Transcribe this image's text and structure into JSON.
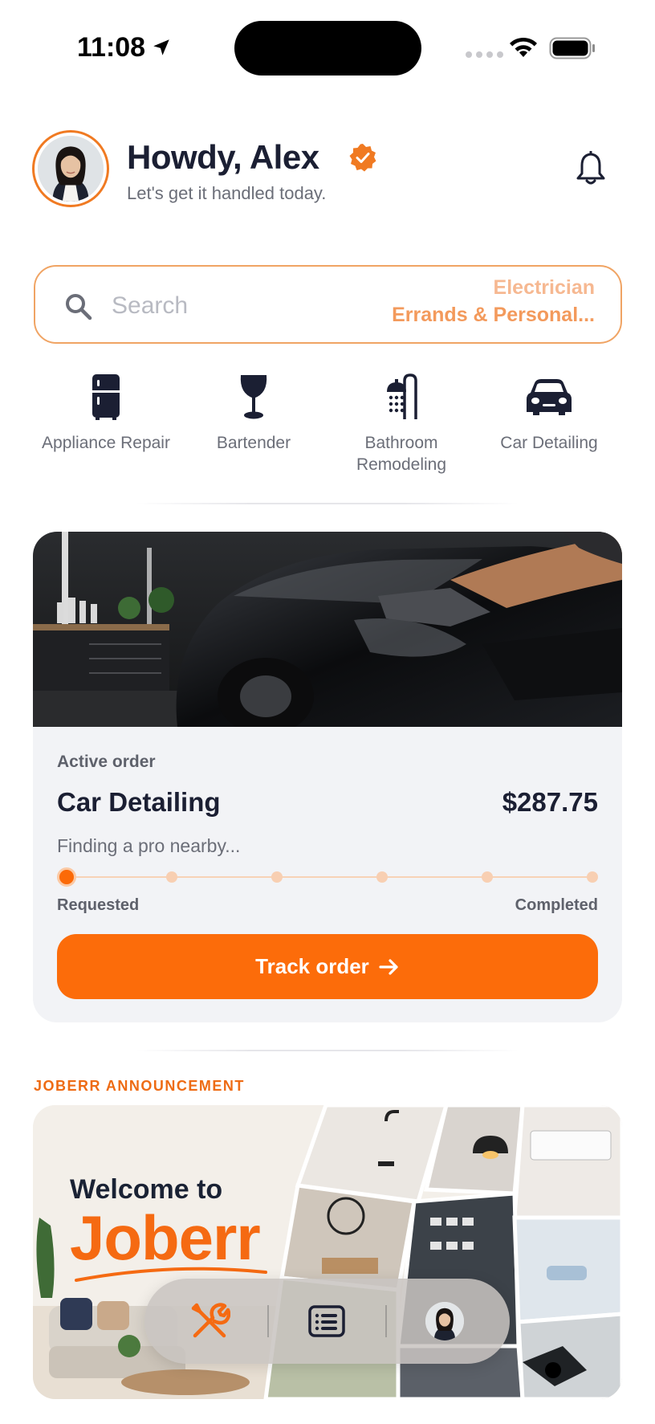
{
  "status_bar": {
    "time": "11:08",
    "icons": [
      "location-arrow-icon",
      "signal-dots-icon",
      "wifi-icon",
      "battery-icon"
    ]
  },
  "header": {
    "greeting": "Howdy, Alex",
    "subtitle": "Let's get it handled today.",
    "verified_icon": "verified-badge-icon",
    "notification_icon": "bell-icon"
  },
  "search": {
    "placeholder": "Search",
    "suggestions": [
      "Electrician",
      "Errands & Personal..."
    ]
  },
  "categories": [
    {
      "label": "Appliance Repair",
      "icon": "refrigerator-icon"
    },
    {
      "label": "Bartender",
      "icon": "wine-glass-icon"
    },
    {
      "label": "Bathroom Remodeling",
      "icon": "shower-icon"
    },
    {
      "label": "Car Detailing",
      "icon": "car-icon"
    }
  ],
  "active_order": {
    "label": "Active order",
    "service": "Car Detailing",
    "price": "$287.75",
    "status": "Finding a pro nearby...",
    "progress_steps_total": 6,
    "progress_step_current": 1,
    "step_start_label": "Requested",
    "step_end_label": "Completed",
    "button_label": "Track order"
  },
  "announcement": {
    "section_label": "JOBERR ANNOUNCEMENT",
    "welcome": "Welcome to",
    "brand": "Joberr"
  },
  "tabbar": {
    "tabs": [
      "tools-icon",
      "list-icon",
      "profile-avatar"
    ]
  },
  "colors": {
    "accent": "#fc6c0a",
    "text_dark": "#1b1f33",
    "muted": "#6b6e78",
    "card_bg": "#f2f3f6"
  }
}
